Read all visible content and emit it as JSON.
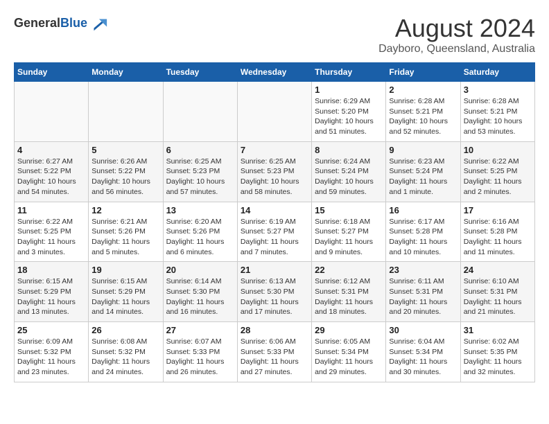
{
  "header": {
    "logo_general": "General",
    "logo_blue": "Blue",
    "month_year": "August 2024",
    "location": "Dayboro, Queensland, Australia"
  },
  "calendar": {
    "day_headers": [
      "Sunday",
      "Monday",
      "Tuesday",
      "Wednesday",
      "Thursday",
      "Friday",
      "Saturday"
    ],
    "weeks": [
      [
        {
          "day": "",
          "info": ""
        },
        {
          "day": "",
          "info": ""
        },
        {
          "day": "",
          "info": ""
        },
        {
          "day": "",
          "info": ""
        },
        {
          "day": "1",
          "info": "Sunrise: 6:29 AM\nSunset: 5:20 PM\nDaylight: 10 hours and 51 minutes."
        },
        {
          "day": "2",
          "info": "Sunrise: 6:28 AM\nSunset: 5:21 PM\nDaylight: 10 hours and 52 minutes."
        },
        {
          "day": "3",
          "info": "Sunrise: 6:28 AM\nSunset: 5:21 PM\nDaylight: 10 hours and 53 minutes."
        }
      ],
      [
        {
          "day": "4",
          "info": "Sunrise: 6:27 AM\nSunset: 5:22 PM\nDaylight: 10 hours and 54 minutes."
        },
        {
          "day": "5",
          "info": "Sunrise: 6:26 AM\nSunset: 5:22 PM\nDaylight: 10 hours and 56 minutes."
        },
        {
          "day": "6",
          "info": "Sunrise: 6:25 AM\nSunset: 5:23 PM\nDaylight: 10 hours and 57 minutes."
        },
        {
          "day": "7",
          "info": "Sunrise: 6:25 AM\nSunset: 5:23 PM\nDaylight: 10 hours and 58 minutes."
        },
        {
          "day": "8",
          "info": "Sunrise: 6:24 AM\nSunset: 5:24 PM\nDaylight: 10 hours and 59 minutes."
        },
        {
          "day": "9",
          "info": "Sunrise: 6:23 AM\nSunset: 5:24 PM\nDaylight: 11 hours and 1 minute."
        },
        {
          "day": "10",
          "info": "Sunrise: 6:22 AM\nSunset: 5:25 PM\nDaylight: 11 hours and 2 minutes."
        }
      ],
      [
        {
          "day": "11",
          "info": "Sunrise: 6:22 AM\nSunset: 5:25 PM\nDaylight: 11 hours and 3 minutes."
        },
        {
          "day": "12",
          "info": "Sunrise: 6:21 AM\nSunset: 5:26 PM\nDaylight: 11 hours and 5 minutes."
        },
        {
          "day": "13",
          "info": "Sunrise: 6:20 AM\nSunset: 5:26 PM\nDaylight: 11 hours and 6 minutes."
        },
        {
          "day": "14",
          "info": "Sunrise: 6:19 AM\nSunset: 5:27 PM\nDaylight: 11 hours and 7 minutes."
        },
        {
          "day": "15",
          "info": "Sunrise: 6:18 AM\nSunset: 5:27 PM\nDaylight: 11 hours and 9 minutes."
        },
        {
          "day": "16",
          "info": "Sunrise: 6:17 AM\nSunset: 5:28 PM\nDaylight: 11 hours and 10 minutes."
        },
        {
          "day": "17",
          "info": "Sunrise: 6:16 AM\nSunset: 5:28 PM\nDaylight: 11 hours and 11 minutes."
        }
      ],
      [
        {
          "day": "18",
          "info": "Sunrise: 6:15 AM\nSunset: 5:29 PM\nDaylight: 11 hours and 13 minutes."
        },
        {
          "day": "19",
          "info": "Sunrise: 6:15 AM\nSunset: 5:29 PM\nDaylight: 11 hours and 14 minutes."
        },
        {
          "day": "20",
          "info": "Sunrise: 6:14 AM\nSunset: 5:30 PM\nDaylight: 11 hours and 16 minutes."
        },
        {
          "day": "21",
          "info": "Sunrise: 6:13 AM\nSunset: 5:30 PM\nDaylight: 11 hours and 17 minutes."
        },
        {
          "day": "22",
          "info": "Sunrise: 6:12 AM\nSunset: 5:31 PM\nDaylight: 11 hours and 18 minutes."
        },
        {
          "day": "23",
          "info": "Sunrise: 6:11 AM\nSunset: 5:31 PM\nDaylight: 11 hours and 20 minutes."
        },
        {
          "day": "24",
          "info": "Sunrise: 6:10 AM\nSunset: 5:31 PM\nDaylight: 11 hours and 21 minutes."
        }
      ],
      [
        {
          "day": "25",
          "info": "Sunrise: 6:09 AM\nSunset: 5:32 PM\nDaylight: 11 hours and 23 minutes."
        },
        {
          "day": "26",
          "info": "Sunrise: 6:08 AM\nSunset: 5:32 PM\nDaylight: 11 hours and 24 minutes."
        },
        {
          "day": "27",
          "info": "Sunrise: 6:07 AM\nSunset: 5:33 PM\nDaylight: 11 hours and 26 minutes."
        },
        {
          "day": "28",
          "info": "Sunrise: 6:06 AM\nSunset: 5:33 PM\nDaylight: 11 hours and 27 minutes."
        },
        {
          "day": "29",
          "info": "Sunrise: 6:05 AM\nSunset: 5:34 PM\nDaylight: 11 hours and 29 minutes."
        },
        {
          "day": "30",
          "info": "Sunrise: 6:04 AM\nSunset: 5:34 PM\nDaylight: 11 hours and 30 minutes."
        },
        {
          "day": "31",
          "info": "Sunrise: 6:02 AM\nSunset: 5:35 PM\nDaylight: 11 hours and 32 minutes."
        }
      ]
    ]
  }
}
